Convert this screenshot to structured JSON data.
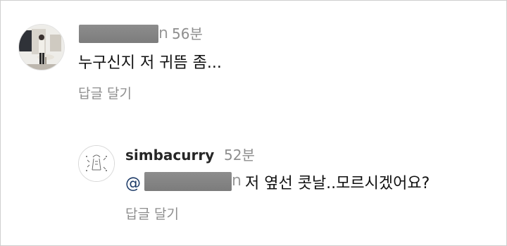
{
  "comment_1": {
    "username_visible_tail": "n",
    "time": "56분",
    "text": "누구신지 저 귀뜸 좀...",
    "reply_label": "답글 달기"
  },
  "comment_2": {
    "username": "simbacurry",
    "time": "52분",
    "mention_prefix": "@",
    "mention_visible_tail": "n",
    "text": "저 옆선 콧날..모르시겠어요?",
    "reply_label": "답글 달기"
  },
  "colors": {
    "text_primary": "#111111",
    "text_secondary": "#8e8e8e",
    "mention": "#1d3b68",
    "redaction": "#858585"
  },
  "icons": {
    "avatar_1": "profile-photo-person-at-table",
    "avatar_2": "profile-logo-line-drawing"
  }
}
